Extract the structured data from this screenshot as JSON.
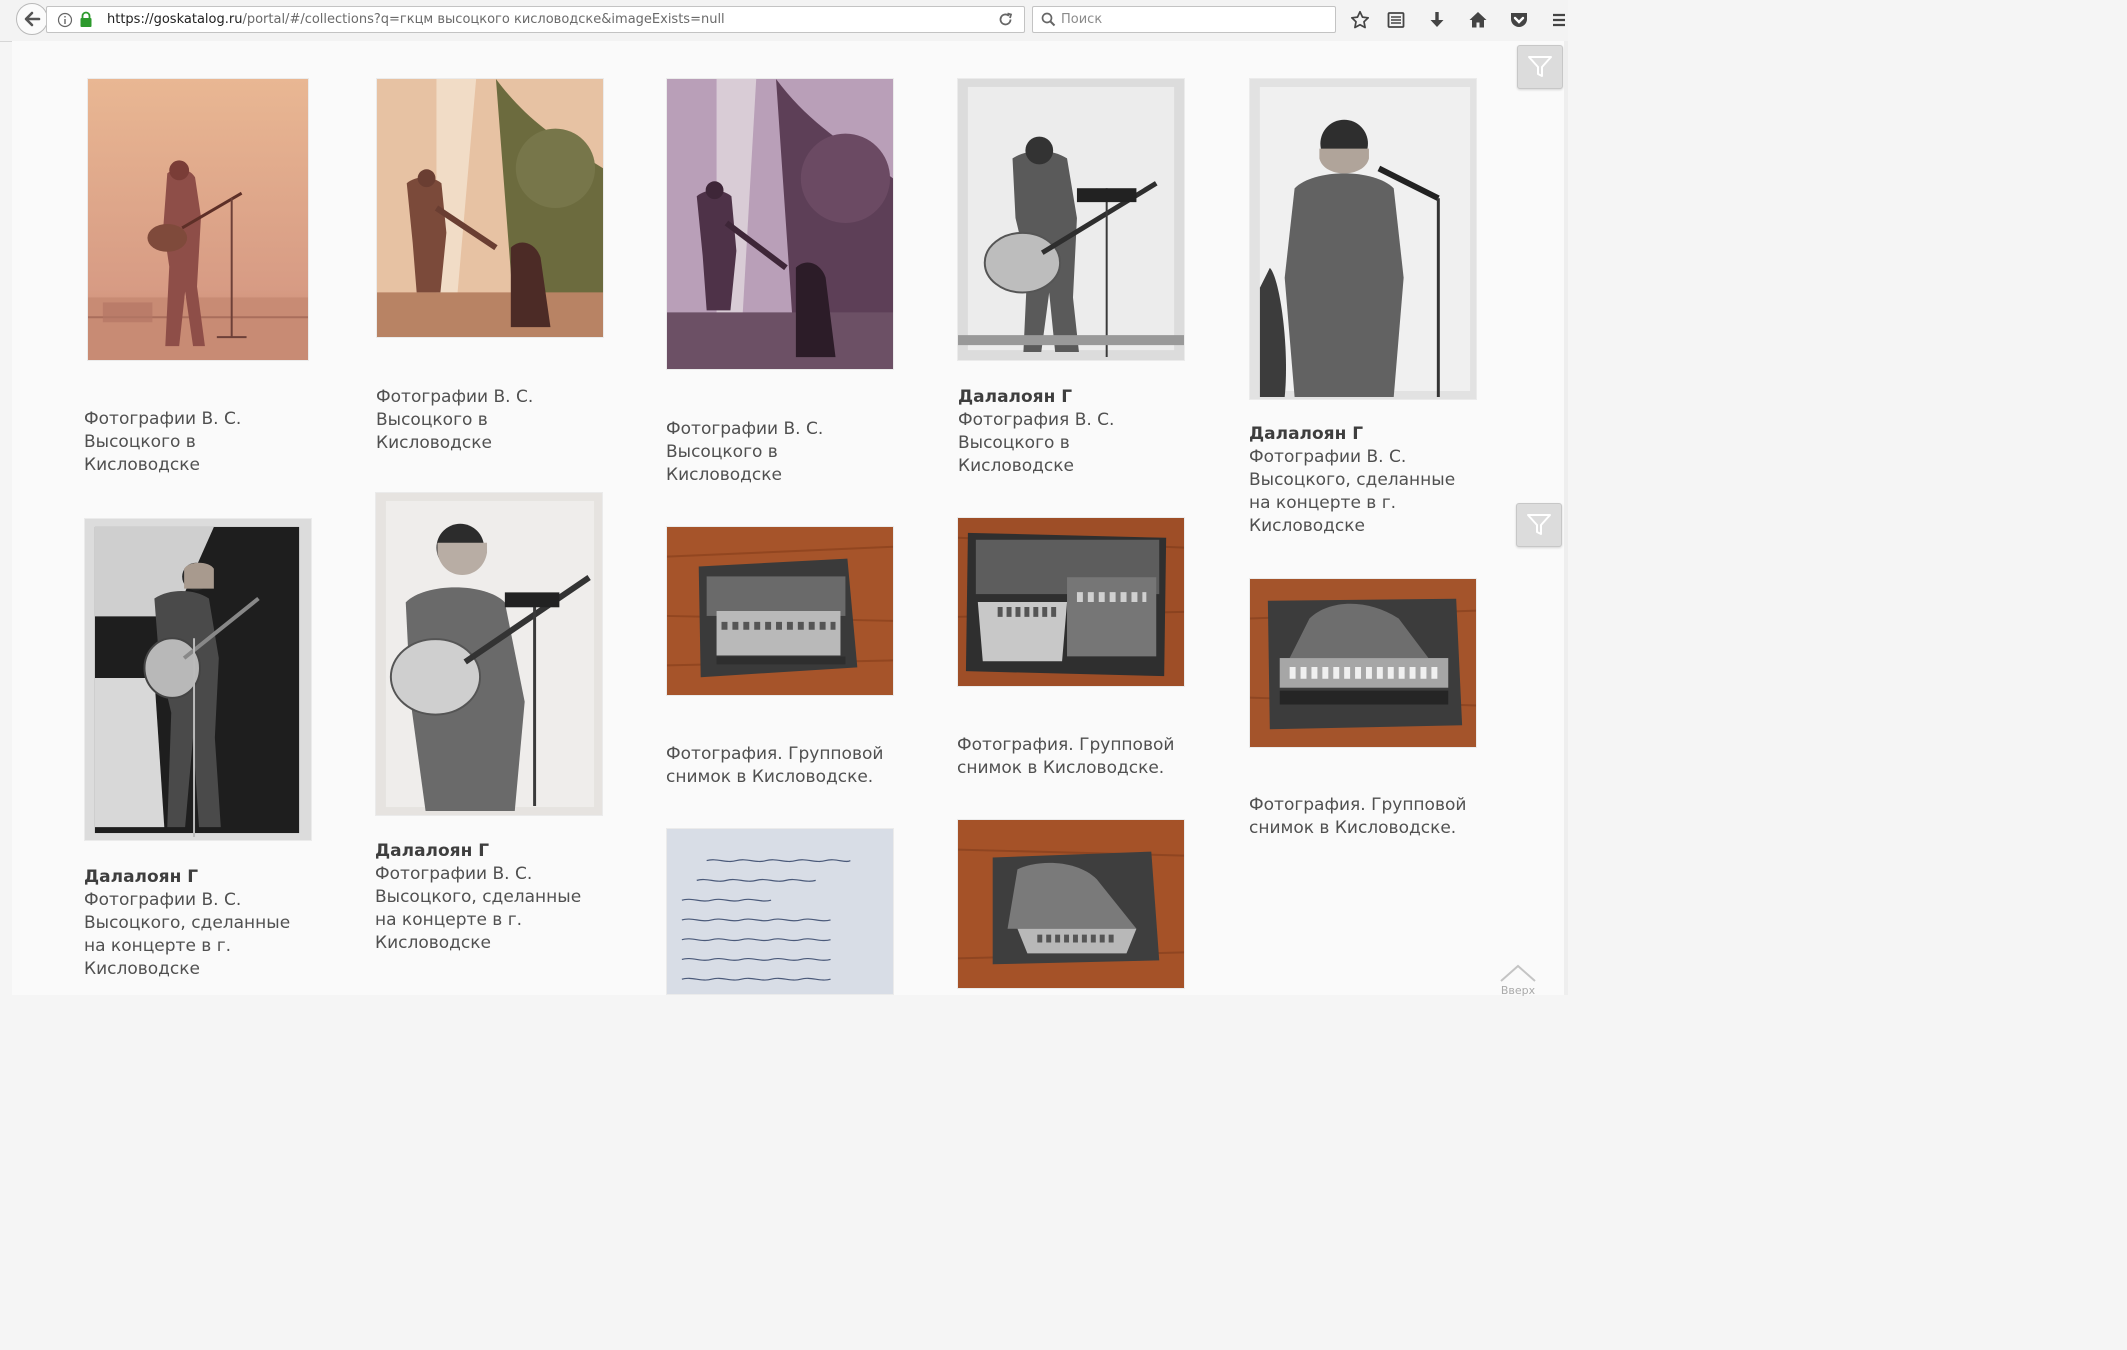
{
  "browser": {
    "url_host": "https://goskatalog.ru",
    "url_path": "/portal/#/collections?q=гкцм высоцкого кисловодске&imageExists=null",
    "search_placeholder": "Поиск"
  },
  "results": [
    {
      "author": "",
      "caption": "Фотографии В. С. Высоцкого в Кисловодске",
      "image": "concert-sepia-guitar-photo"
    },
    {
      "author": "",
      "caption": "Фотографии В. С. Высоцкого в Кисловодске",
      "image": "concert-sepia-handshake-photo"
    },
    {
      "author": "",
      "caption": "Фотографии В. С. Высоцкого в Кисловодске",
      "image": "concert-purple-handshake-photo"
    },
    {
      "author": "Далалоян Г",
      "caption": "Фотография В. С. Высоцкого в Кисловодске",
      "image": "concert-bw-guitar-photo"
    },
    {
      "author": "Далалоян Г",
      "caption": "Фотографии В. С. Высоцкого, сделанные на концерте в г. Кисловодске",
      "image": "concert-bw-microphone-photo"
    },
    {
      "author": "Далалоян Г",
      "caption": "Фотографии В. С. Высоцкого, сделанные на концерте в г. Кисловодске",
      "image": "concert-bw-dark-stage-photo"
    },
    {
      "author": "Далалоян Г",
      "caption": "Фотографии В. С. Высоцкого, сделанные на концерте в г. Кисловодске",
      "image": "concert-bw-guitar-closeup-photo"
    },
    {
      "author": "",
      "caption": "Фотография. Групповой снимок в Кисловодске.",
      "image": "group-photo-on-wood"
    },
    {
      "author": "",
      "caption": "Фотография. Групповой снимок в Кисловодске.",
      "image": "group-photo-waterfall-on-wood"
    },
    {
      "author": "",
      "caption": "Фотография. Групповой снимок в Кисловодске.",
      "image": "group-photo-rocks-on-wood"
    },
    {
      "author": "",
      "caption": "",
      "image": "handwritten-letter-photo"
    },
    {
      "author": "",
      "caption": "",
      "image": "rock-group-photo-on-wood"
    }
  ],
  "scroll_top_label": "Вверх"
}
